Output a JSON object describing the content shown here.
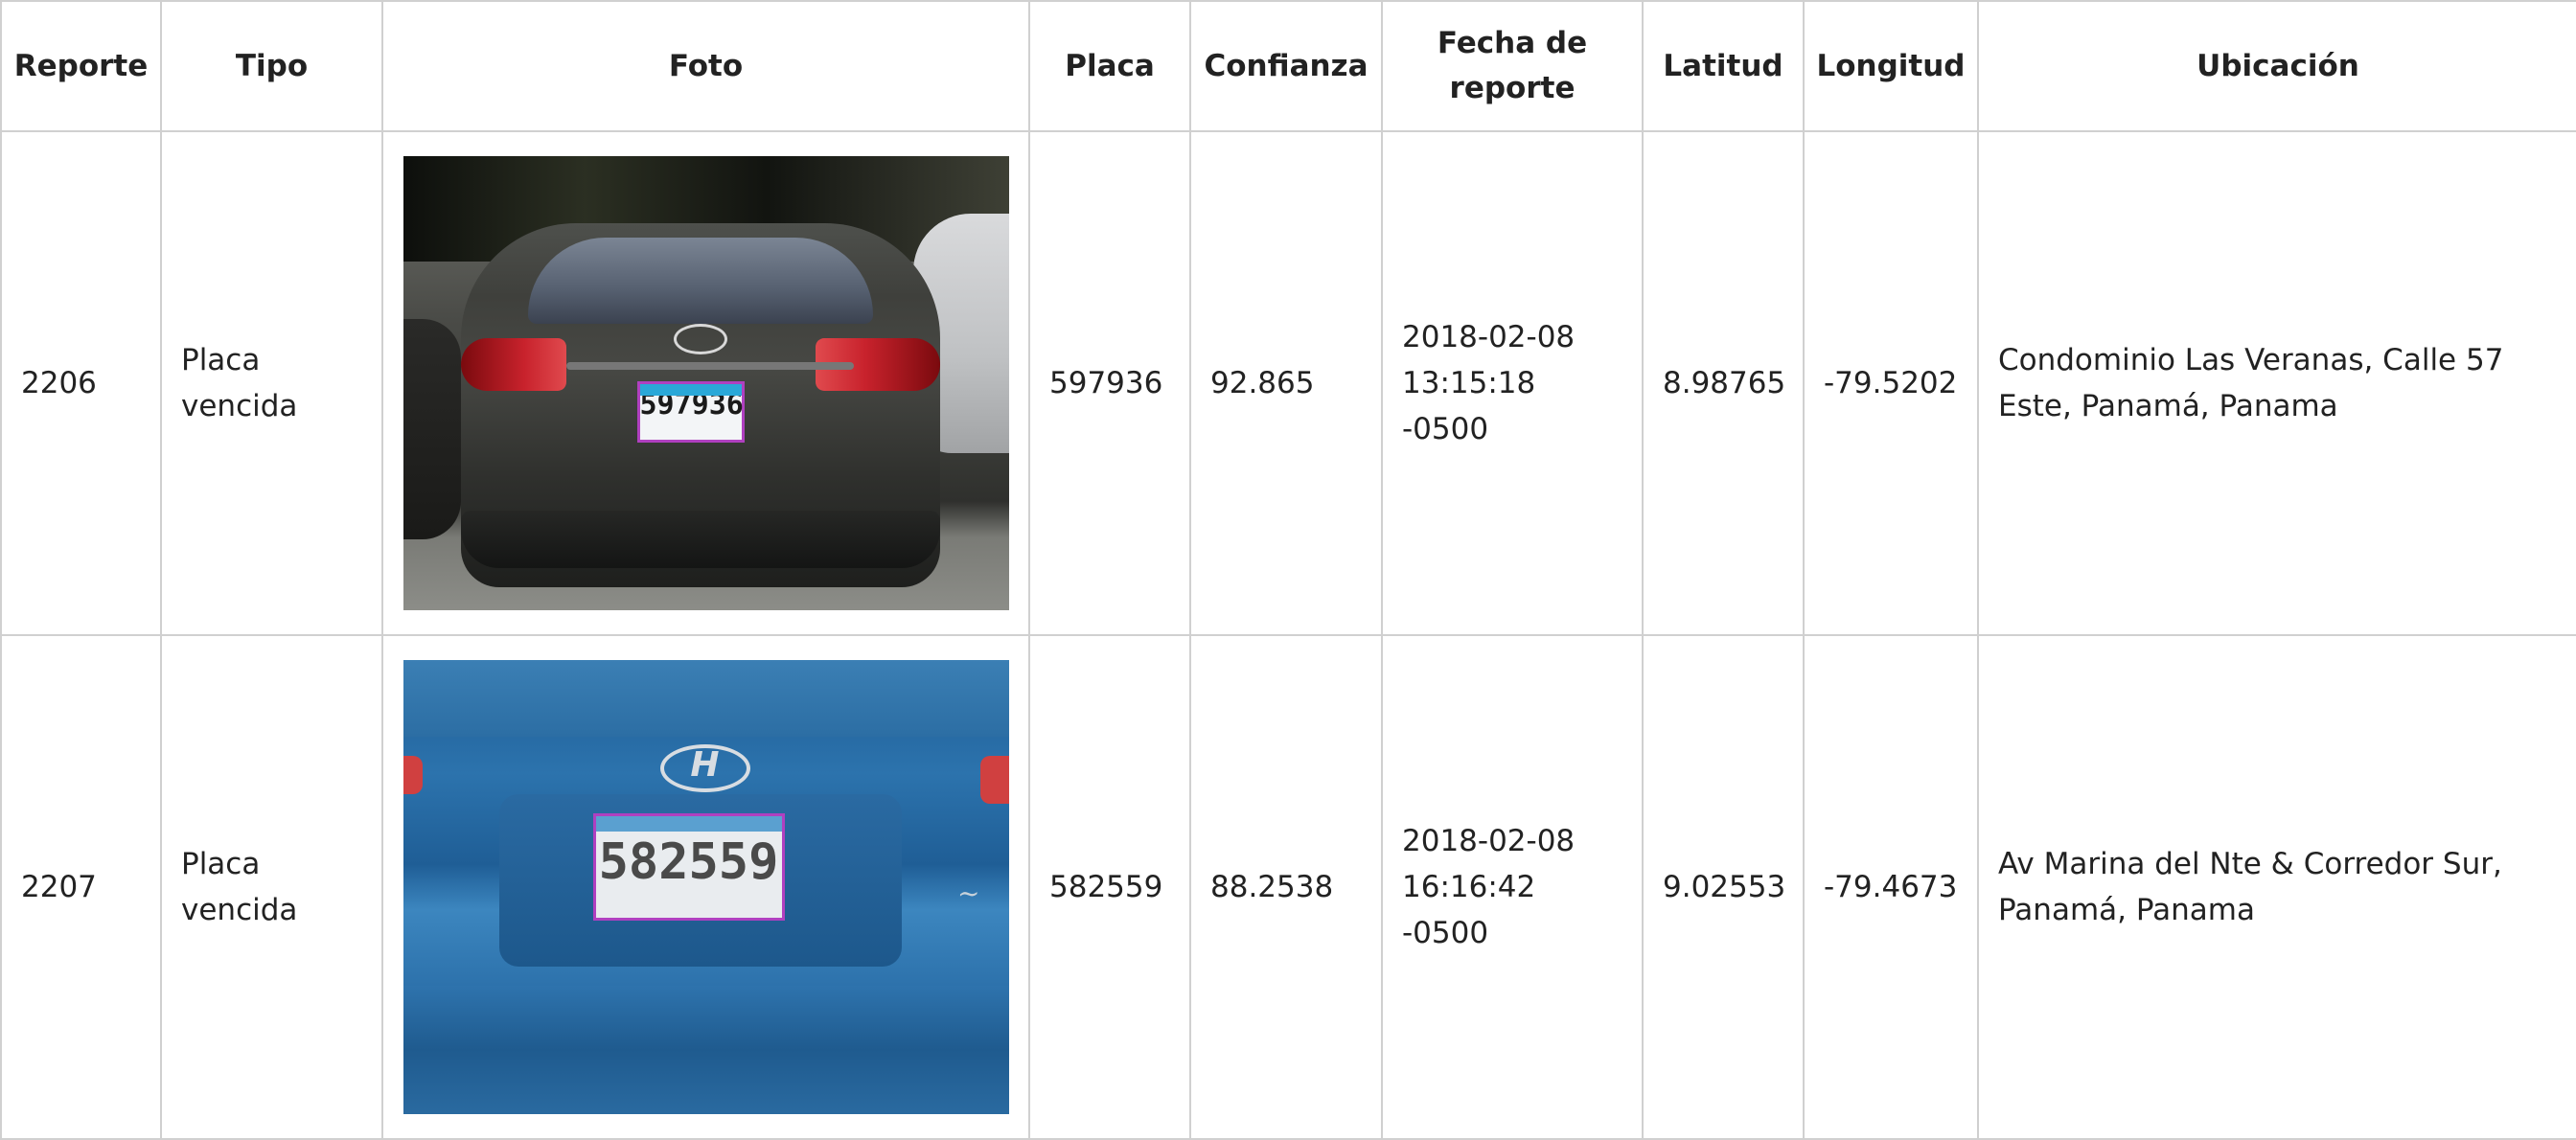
{
  "headers": [
    "Reporte",
    "Tipo",
    "Foto",
    "Placa",
    "Confianza",
    "Fecha de reporte",
    "Latitud",
    "Longitud",
    "Ubicación"
  ],
  "rows": [
    {
      "reporte": "2206",
      "tipo": "Placa vencida",
      "placa": "597936",
      "confianza": "92.865",
      "fecha": "2018-02-08 13:15:18 -0500",
      "latitud": "8.98765",
      "longitud": "-79.5202",
      "ubicacion": "Condominio Las Veranas, Calle 57 Este, Panamá, Panama",
      "photo_plate_text": "597936"
    },
    {
      "reporte": "2207",
      "tipo": "Placa vencida",
      "placa": "582559",
      "confianza": "88.2538",
      "fecha": "2018-02-08 16:16:42 -0500",
      "latitud": "9.02553",
      "longitud": "-79.4673",
      "ubicacion": "Av Marina del Nte & Corredor Sur, Panamá, Panama",
      "photo_plate_text": "582559"
    }
  ],
  "colors": {
    "border": "#d0d0d0",
    "text": "#222222",
    "plate_highlight": "#b040c0"
  }
}
